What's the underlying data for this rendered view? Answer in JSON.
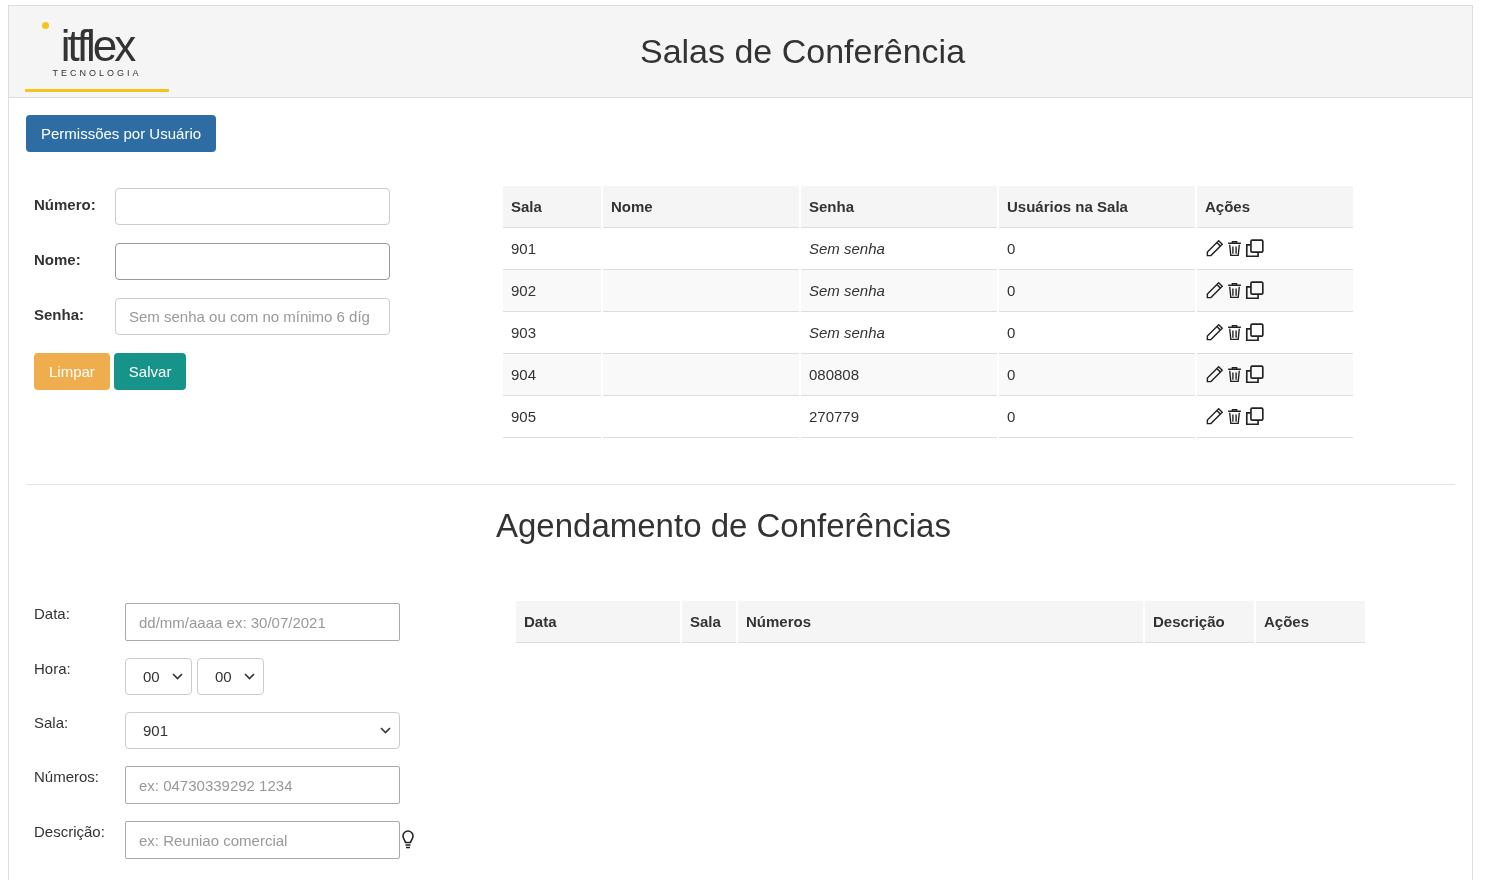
{
  "header": {
    "logo": {
      "wordmark": "itflex",
      "tagline": "TECNOLOGIA"
    },
    "title": "Salas de Conferência"
  },
  "permissions_button": "Permissões por Usuário",
  "room_form": {
    "fields": [
      {
        "label": "Número:"
      },
      {
        "label": "Nome:"
      },
      {
        "label": "Senha:",
        "placeholder": "Sem senha ou com no mínimo 6 díg"
      }
    ],
    "buttons": [
      {
        "label": "Limpar",
        "kind": "warning"
      },
      {
        "label": "Salvar",
        "kind": "success"
      }
    ]
  },
  "rooms_table": {
    "columns": [
      "Sala",
      "Nome",
      "Senha",
      "Usuários na Sala",
      "Ações"
    ],
    "rows": [
      {
        "sala": "901",
        "senha": "Sem senha",
        "password_set": false,
        "users": "0"
      },
      {
        "sala": "902",
        "senha": "Sem senha",
        "password_set": false,
        "users": "0"
      },
      {
        "sala": "903",
        "senha": "Sem senha",
        "password_set": false,
        "users": "0"
      },
      {
        "sala": "904",
        "senha": "080808",
        "password_set": true,
        "users": "0"
      },
      {
        "sala": "905",
        "senha": "270779",
        "password_set": true,
        "users": "0"
      }
    ]
  },
  "schedule": {
    "title": "Agendamento de Conferências",
    "form": [
      {
        "kind": "input",
        "label": "Data:",
        "placeholder": "dd/mm/aaaa ex: 30/07/2021"
      },
      {
        "kind": "time",
        "label": "Hora:",
        "hour": "00",
        "minute": "00"
      },
      {
        "kind": "select",
        "label": "Sala:",
        "value": "901"
      },
      {
        "kind": "input",
        "label": "Números:",
        "placeholder": "ex: 04730339292 1234"
      },
      {
        "kind": "hint",
        "label": "Descrição:",
        "placeholder": "ex: Reuniao comercial"
      }
    ],
    "table": {
      "columns": [
        "Data",
        "Sala",
        "Números",
        "Descrição",
        "Ações"
      ]
    }
  }
}
